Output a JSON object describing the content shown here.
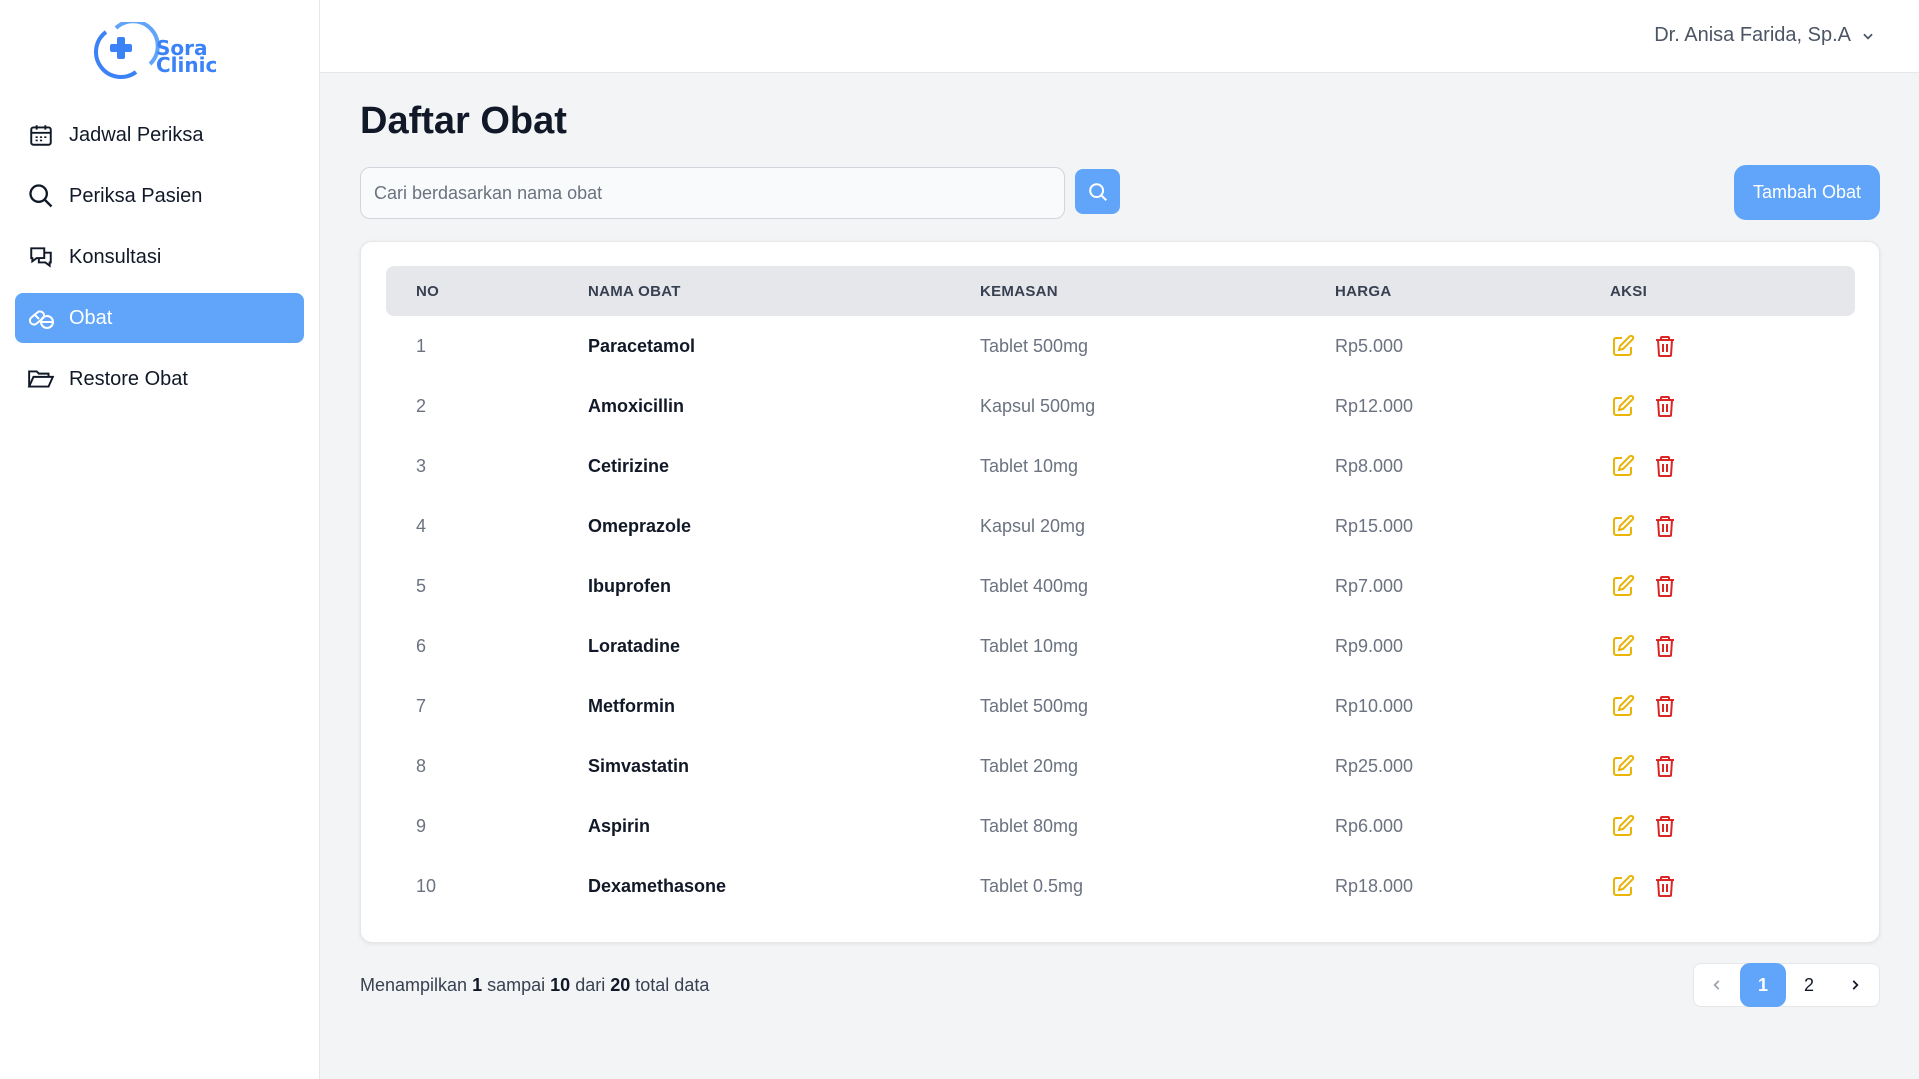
{
  "brand": {
    "line1": "Sora",
    "line2": "Clinic",
    "color": "#3b82f6"
  },
  "sidebar": {
    "items": [
      {
        "label": "Jadwal Periksa",
        "icon": "calendar-icon",
        "active": false
      },
      {
        "label": "Periksa Pasien",
        "icon": "search-icon",
        "active": false
      },
      {
        "label": "Konsultasi",
        "icon": "chat-icon",
        "active": false
      },
      {
        "label": "Obat",
        "icon": "pills-icon",
        "active": true
      },
      {
        "label": "Restore Obat",
        "icon": "folder-open-icon",
        "active": false
      }
    ]
  },
  "header": {
    "user_name": "Dr. Anisa Farida, Sp.A"
  },
  "main": {
    "title": "Daftar Obat",
    "search_placeholder": "Cari berdasarkan nama obat",
    "add_button": "Tambah Obat",
    "table": {
      "headers": {
        "no": "NO",
        "name": "NAMA OBAT",
        "kemasan": "KEMASAN",
        "harga": "HARGA",
        "aksi": "AKSI"
      },
      "rows": [
        {
          "no": "1",
          "name": "Paracetamol",
          "kemasan": "Tablet 500mg",
          "harga": "Rp5.000"
        },
        {
          "no": "2",
          "name": "Amoxicillin",
          "kemasan": "Kapsul 500mg",
          "harga": "Rp12.000"
        },
        {
          "no": "3",
          "name": "Cetirizine",
          "kemasan": "Tablet 10mg",
          "harga": "Rp8.000"
        },
        {
          "no": "4",
          "name": "Omeprazole",
          "kemasan": "Kapsul 20mg",
          "harga": "Rp15.000"
        },
        {
          "no": "5",
          "name": "Ibuprofen",
          "kemasan": "Tablet 400mg",
          "harga": "Rp7.000"
        },
        {
          "no": "6",
          "name": "Loratadine",
          "kemasan": "Tablet 10mg",
          "harga": "Rp9.000"
        },
        {
          "no": "7",
          "name": "Metformin",
          "kemasan": "Tablet 500mg",
          "harga": "Rp10.000"
        },
        {
          "no": "8",
          "name": "Simvastatin",
          "kemasan": "Tablet 20mg",
          "harga": "Rp25.000"
        },
        {
          "no": "9",
          "name": "Aspirin",
          "kemasan": "Tablet 80mg",
          "harga": "Rp6.000"
        },
        {
          "no": "10",
          "name": "Dexamethasone",
          "kemasan": "Tablet 0.5mg",
          "harga": "Rp18.000"
        }
      ]
    },
    "footer": {
      "prefix": "Menampilkan",
      "from": "1",
      "mid1": "sampai",
      "to": "10",
      "mid2": "dari",
      "total": "20",
      "suffix": "total data"
    },
    "pagination": {
      "pages": [
        "1",
        "2"
      ],
      "current": "1"
    }
  },
  "colors": {
    "accent": "#60a5fa",
    "edit": "#eab308",
    "delete": "#dc2626"
  }
}
